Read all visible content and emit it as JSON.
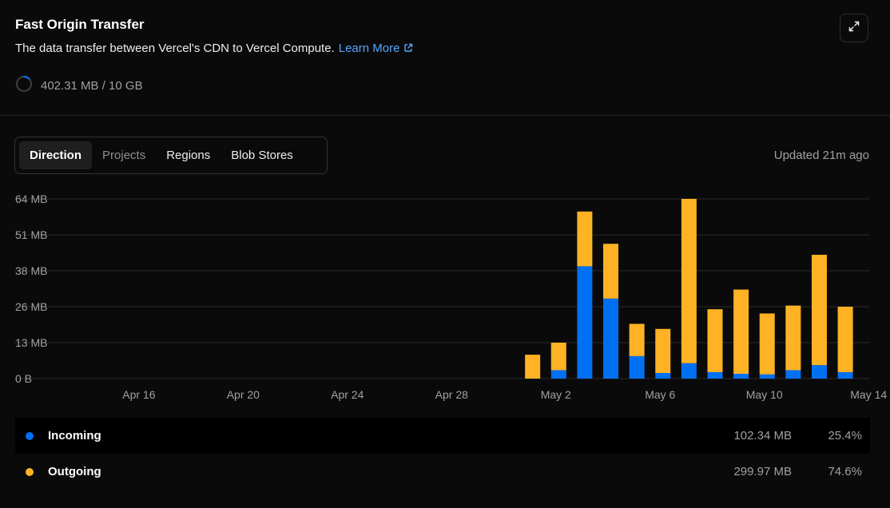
{
  "header": {
    "title": "Fast Origin Transfer",
    "description": "The data transfer between Vercel's CDN to Vercel Compute.",
    "learn_more": "Learn More",
    "usage": "402.31 MB / 10 GB",
    "usage_fraction": 0.0393
  },
  "tabs": [
    {
      "label": "Direction",
      "active": true
    },
    {
      "label": "Projects",
      "active": false
    },
    {
      "label": "Regions",
      "active": false
    },
    {
      "label": "Blob Stores",
      "active": false
    }
  ],
  "updated": "Updated 21m ago",
  "colors": {
    "incoming": "#0070f3",
    "outgoing": "#ffb224",
    "grid": "#2a2a2a",
    "axis_text": "#a1a1a1"
  },
  "chart_data": {
    "type": "bar",
    "stacked": true,
    "y_tick_labels": [
      "0 B",
      "13 MB",
      "26 MB",
      "38 MB",
      "51 MB",
      "64 MB"
    ],
    "ylim": [
      0,
      64
    ],
    "x_tick_labels": [
      "Apr 16",
      "Apr 20",
      "Apr 24",
      "Apr 28",
      "May 2",
      "May 6",
      "May 10",
      "May 14"
    ],
    "categories": [
      "May 1",
      "May 2",
      "May 3",
      "May 4",
      "May 5",
      "May 6",
      "May 7",
      "May 8",
      "May 9",
      "May 10",
      "May 11",
      "May 12",
      "May 13",
      "May 14"
    ],
    "series": [
      {
        "name": "Incoming",
        "values": [
          0,
          3,
          40,
          28.5,
          8,
          2,
          5.5,
          2.3,
          1.7,
          1.5,
          3,
          4.8,
          2.3,
          0
        ]
      },
      {
        "name": "Outgoing",
        "values": [
          8.5,
          9.8,
          19.5,
          19.5,
          11.5,
          15.7,
          58.5,
          22.4,
          30,
          21.7,
          23,
          39.3,
          23.3,
          0
        ]
      }
    ],
    "grid": true,
    "legend": [
      {
        "name": "Incoming",
        "total": "102.34 MB",
        "percent": "25.4%"
      },
      {
        "name": "Outgoing",
        "total": "299.97 MB",
        "percent": "74.6%"
      }
    ]
  }
}
